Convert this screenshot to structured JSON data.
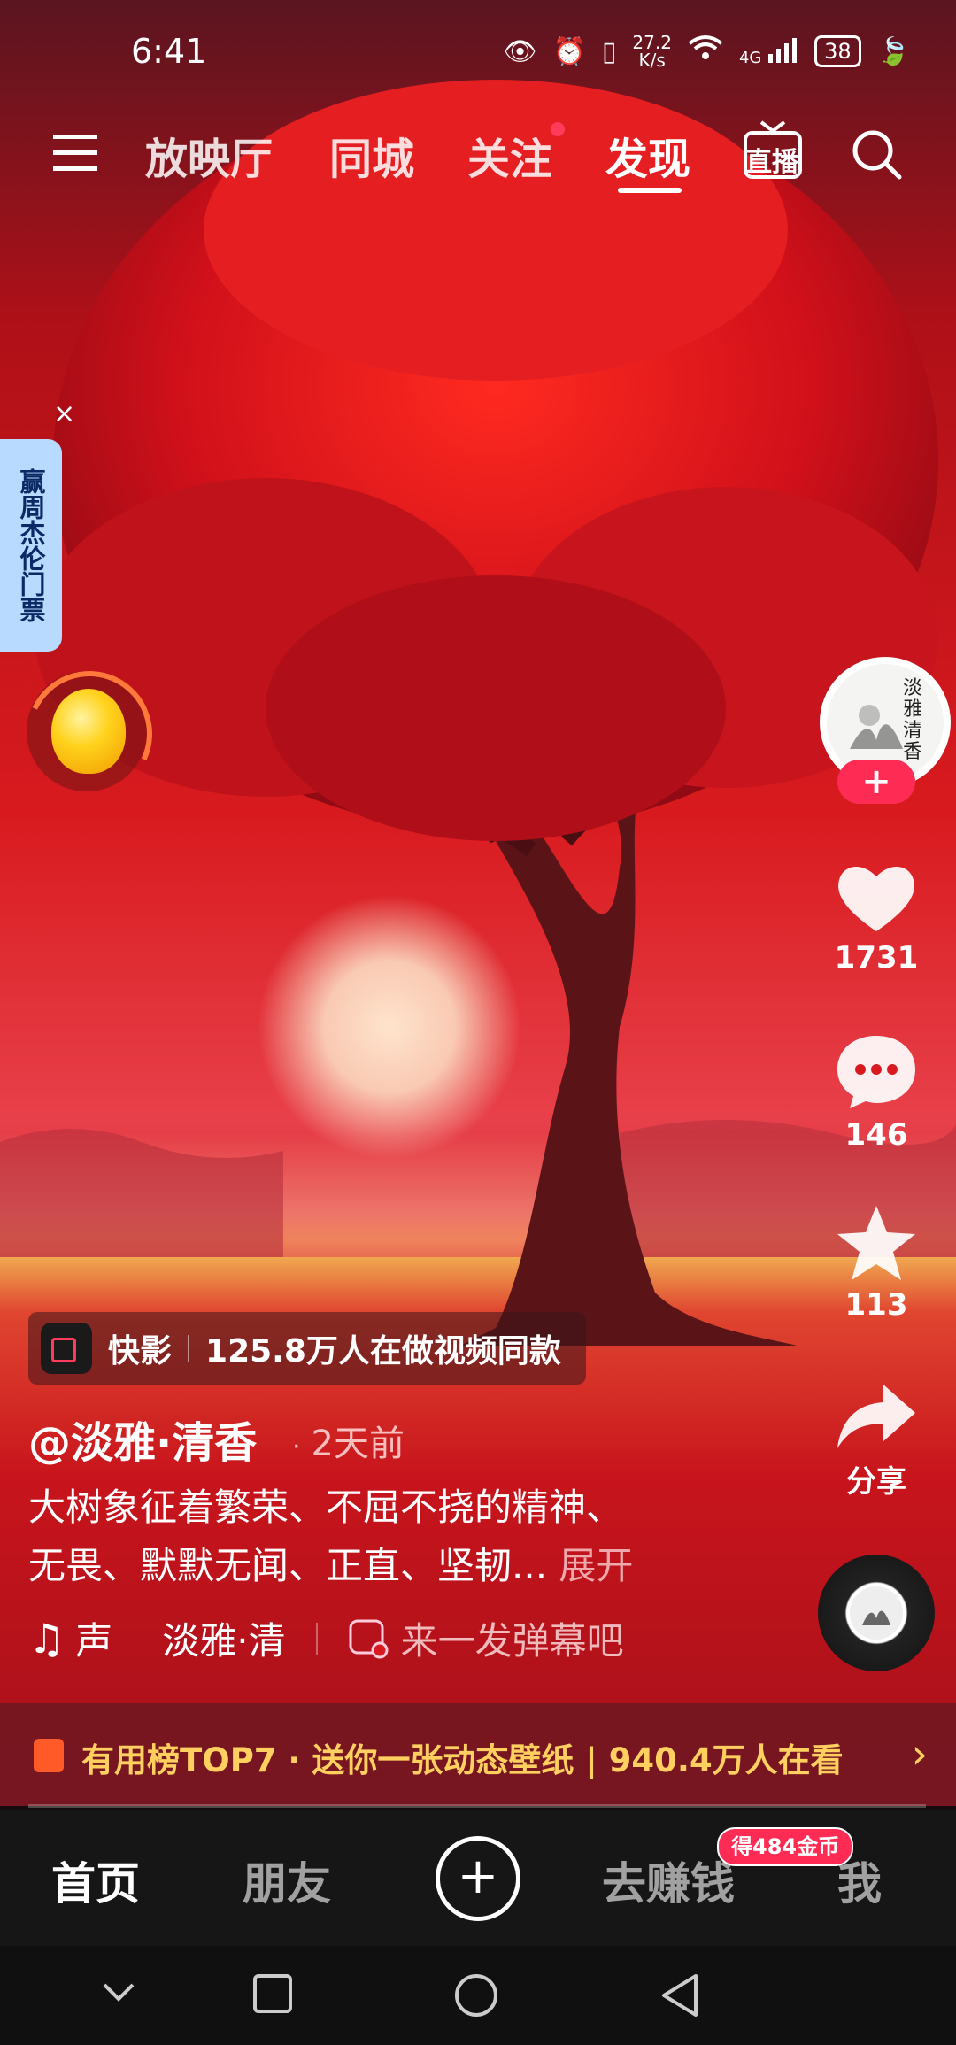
{
  "status_bar": {
    "time": "6:41",
    "net_speed_value": "27.2",
    "net_speed_unit": "K/s",
    "network_type": "4G",
    "battery": "38"
  },
  "top_nav": {
    "tabs": [
      "放映厅",
      "同城",
      "关注",
      "发现"
    ],
    "active_tab": "发现",
    "live_label": "直播"
  },
  "side_promo": {
    "text": "赢周杰伦门票",
    "close": "×"
  },
  "creator": {
    "avatar_text": "淡雅清香"
  },
  "actions": {
    "likes": "1731",
    "comments": "146",
    "favorites": "113",
    "share_label": "分享"
  },
  "template_bar": {
    "app_name": "快影",
    "text": "125.8万人在做视频同款"
  },
  "post": {
    "author": "@淡雅·清香",
    "time_sep": "·",
    "time": "2天前",
    "desc_line1": "大树象征着繁荣、不屈不挠的精神、",
    "desc_line2": "无畏、默默无闻、正直、坚韧...",
    "expand": "展开"
  },
  "music": {
    "label": "声",
    "source": "淡雅·清",
    "danmu_placeholder": "来一发弹幕吧"
  },
  "hot_bar": {
    "text": "有用榜TOP7 · 送你一张动态壁纸 | 940.4万人在看"
  },
  "bottom_tabs": {
    "home": "首页",
    "friends": "朋友",
    "earn": "去赚钱",
    "earn_badge": "得484金币",
    "me": "我"
  },
  "colors": {
    "accent": "#fe2c55",
    "hot_text": "#ffd060",
    "tab_bg": "#161616"
  }
}
